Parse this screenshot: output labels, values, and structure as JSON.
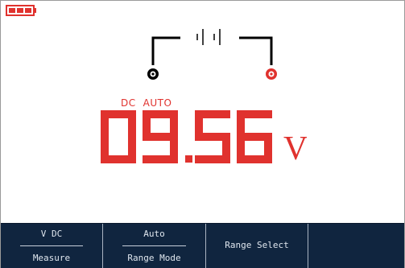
{
  "status": {
    "battery_icon": "battery-full-icon",
    "battery_color": "#e0322e"
  },
  "diagram": {
    "dc_symbol_icon": "dc-voltage-symbol-icon",
    "com_jack_icon": "com-jack-icon",
    "v_jack_icon": "v-jack-icon",
    "com_color": "#000000",
    "v_color": "#e0322e"
  },
  "mode": {
    "coupling": "DC",
    "range": "AUTO"
  },
  "reading": {
    "value": "09.56",
    "unit": "V",
    "color": "#e0322e"
  },
  "softkeys": [
    {
      "top": "V DC",
      "bottom": "Measure"
    },
    {
      "top": "Auto",
      "bottom": "Range Mode"
    },
    {
      "label": "Range Select"
    }
  ],
  "theme": {
    "softkey_bg": "#10253f",
    "softkey_text": "#dfe6ee"
  }
}
